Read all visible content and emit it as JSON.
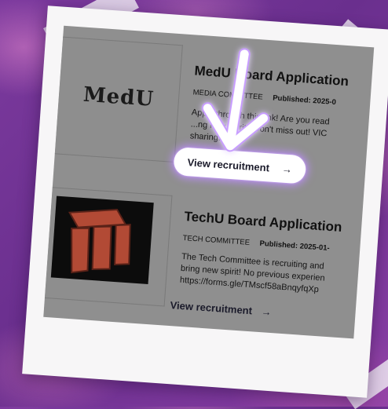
{
  "card1": {
    "logo_text": "MedU",
    "title": "MedU Board Application",
    "committee": "MEDIA COMMITTEE",
    "published": "Published: 2025-0",
    "desc_lines": [
      "Apply through this link!   Are you read",
      "...ng new spirit? Don't miss out!   VIC",
      "sharing..."
    ],
    "cta_label": "View recruitment",
    "cta_arrow": "→"
  },
  "card2": {
    "title": "TechU Board Application",
    "committee": "TECH COMMITTEE",
    "published": "Published: 2025-01-",
    "desc_lines": [
      "The Tech Committee is recruiting and",
      "bring new spirit! No previous experien",
      "https://forms.gle/TMscf58aBnqyfqXp"
    ],
    "cta_label": "View recruitment",
    "cta_arrow": "→"
  },
  "colors": {
    "highlight_glow": "#be8cff",
    "logo_red": "#b24a35",
    "background": "#6a2f8e"
  },
  "icons": {
    "pointer": "down-arrow-pointer-icon"
  }
}
